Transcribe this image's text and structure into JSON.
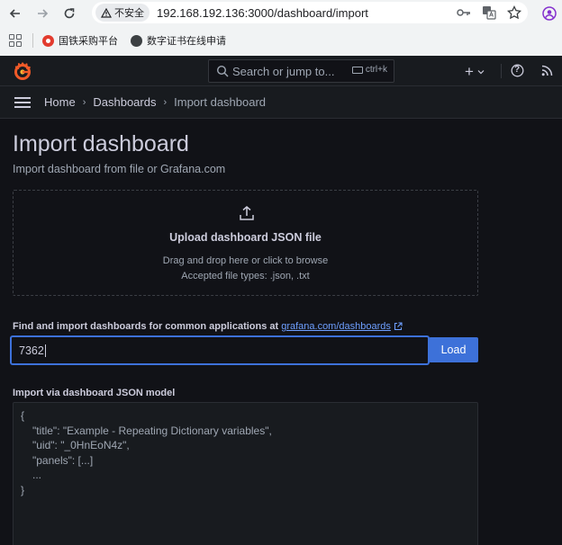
{
  "browser": {
    "security_label": "不安全",
    "url": "192.168.192.136:3000/dashboard/import",
    "bookmarks": [
      {
        "label": "国铁采购平台"
      },
      {
        "label": "数字证书在线申请"
      }
    ]
  },
  "header": {
    "search_placeholder": "Search or jump to...",
    "search_shortcut": "ctrl+k",
    "add_label": "+",
    "help_label": "?"
  },
  "breadcrumb": {
    "items": [
      "Home",
      "Dashboards",
      "Import dashboard"
    ],
    "separator": "›"
  },
  "main": {
    "title": "Import dashboard",
    "subtitle": "Import dashboard from file or Grafana.com",
    "upload": {
      "title": "Upload dashboard JSON file",
      "line1": "Drag and drop here or click to browse",
      "line2": "Accepted file types: .json, .txt"
    },
    "find": {
      "label": "Find and import dashboards for common applications at",
      "link": "grafana.com/dashboards",
      "input_value": "7362",
      "load_label": "Load"
    },
    "json_model": {
      "label": "Import via dashboard JSON model",
      "lines": [
        {
          "text": "{",
          "indent": false
        },
        {
          "text": "\"title\": \"Example - Repeating Dictionary variables\",",
          "indent": true
        },
        {
          "text": "\"uid\": \"_0HnEoN4z\",",
          "indent": true
        },
        {
          "text": "\"panels\": [...]",
          "indent": true
        },
        {
          "text": "...",
          "indent": true
        },
        {
          "text": "}",
          "indent": false
        }
      ]
    }
  },
  "colors": {
    "background": "#111217",
    "panel": "#181b1f",
    "primary": "#3d71d9",
    "link": "#6e9fff",
    "grafana_orange": "#f05a28"
  }
}
